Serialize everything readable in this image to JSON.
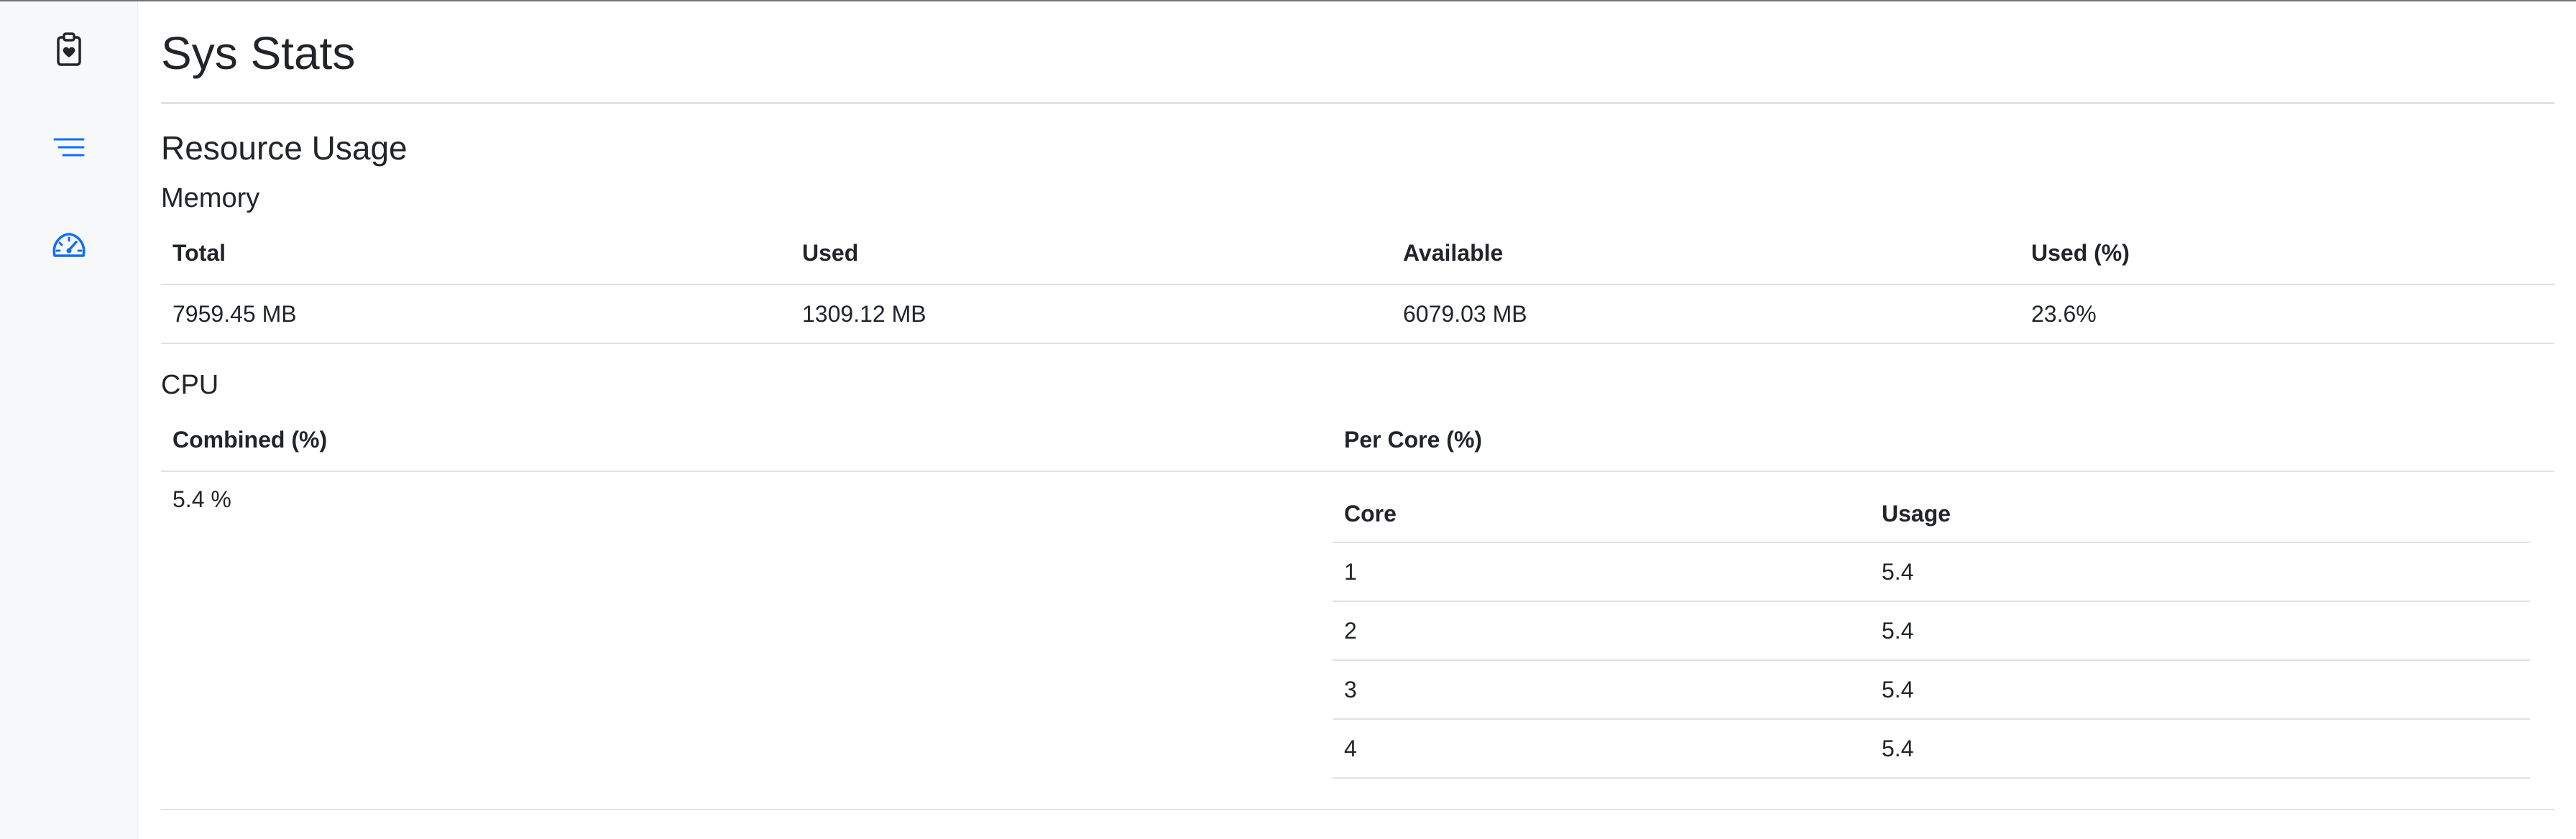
{
  "app": {
    "title": "Sys Stats"
  },
  "sidebar": {
    "items": [
      {
        "icon": "clipboard-heart-icon",
        "active": false
      },
      {
        "icon": "list-icon",
        "active": true
      },
      {
        "icon": "speedometer-icon",
        "active": false
      }
    ],
    "accent_color": "#0d6efd",
    "icon_color": "#212529"
  },
  "resource_usage": {
    "heading": "Resource Usage",
    "memory": {
      "heading": "Memory",
      "columns": [
        "Total",
        "Used",
        "Available",
        "Used (%)"
      ],
      "row": [
        "7959.45 MB",
        "1309.12 MB",
        "6079.03 MB",
        "23.6%"
      ]
    },
    "cpu": {
      "heading": "CPU",
      "columns": [
        "Combined (%)",
        "Per Core (%)"
      ],
      "combined_value": "5.4 %",
      "per_core": {
        "columns": [
          "Core",
          "Usage"
        ],
        "rows": [
          [
            "1",
            "5.4"
          ],
          [
            "2",
            "5.4"
          ],
          [
            "3",
            "5.4"
          ],
          [
            "4",
            "5.4"
          ]
        ]
      }
    }
  }
}
